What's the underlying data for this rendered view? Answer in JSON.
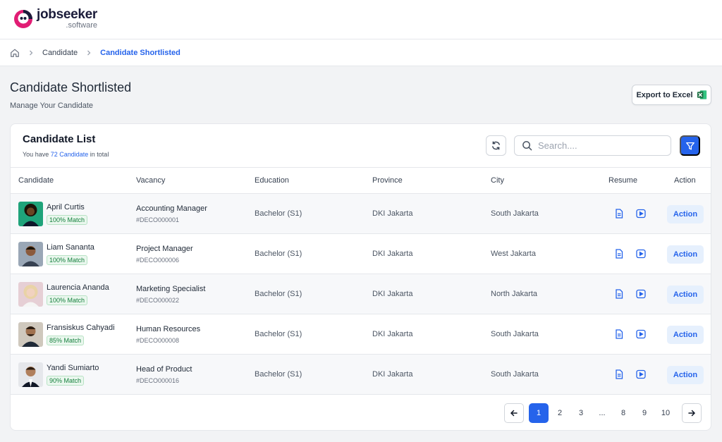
{
  "brand": {
    "name": "jobseeker",
    "sub": ".software"
  },
  "breadcrumb": {
    "items": [
      "Candidate",
      "Candidate Shortlisted"
    ]
  },
  "header": {
    "title": "Candidate Shortlisted",
    "subtitle": "Manage Your Candidate",
    "export_label": "Export to Excel"
  },
  "card": {
    "title": "Candidate List",
    "sub_prefix": "You have",
    "count_text": "72 Candidate",
    "sub_suffix": "in total",
    "search_placeholder": "Search...."
  },
  "table": {
    "columns": [
      "Candidate",
      "Vacancy",
      "Education",
      "Province",
      "City",
      "Resume",
      "Action"
    ],
    "rows": [
      {
        "name": "April Curtis",
        "match": "100% Match",
        "vacancy": "Accounting Manager",
        "code": "#DECO000001",
        "education": "Bachelor (S1)",
        "province": "DKI Jakarta",
        "city": "South Jakarta",
        "action": "Action"
      },
      {
        "name": "Liam Sananta",
        "match": "100% Match",
        "vacancy": "Project Manager",
        "code": "#DECO000006",
        "education": "Bachelor (S1)",
        "province": "DKI Jakarta",
        "city": "West Jakarta",
        "action": "Action"
      },
      {
        "name": "Laurencia Ananda",
        "match": "100% Match",
        "vacancy": "Marketing Specialist",
        "code": "#DECO000022",
        "education": "Bachelor (S1)",
        "province": "DKI Jakarta",
        "city": "North Jakarta",
        "action": "Action"
      },
      {
        "name": "Fransiskus Cahyadi",
        "match": "85% Match",
        "vacancy": "Human Resources",
        "code": "#DECO000008",
        "education": "Bachelor (S1)",
        "province": "DKI Jakarta",
        "city": "South Jakarta",
        "action": "Action"
      },
      {
        "name": "Yandi Sumiarto",
        "match": "90% Match",
        "vacancy": "Head of Product",
        "code": "#DECO000016",
        "education": "Bachelor (S1)",
        "province": "DKI Jakarta",
        "city": "South Jakarta",
        "action": "Action"
      }
    ]
  },
  "pagination": {
    "pages": [
      "1",
      "2",
      "3",
      "...",
      "8",
      "9",
      "10"
    ],
    "current": "1"
  },
  "colors": {
    "accent": "#2563eb",
    "brand_pink": "#e11d74",
    "brand_navy": "#1b1c3a",
    "match_green": "#15803d",
    "excel_green": "#1d7044"
  },
  "icons": [
    "home-icon",
    "chevron-right-icon",
    "excel-icon",
    "refresh-icon",
    "search-icon",
    "filter-icon",
    "document-icon",
    "play-icon",
    "arrow-left-icon",
    "arrow-right-icon"
  ]
}
